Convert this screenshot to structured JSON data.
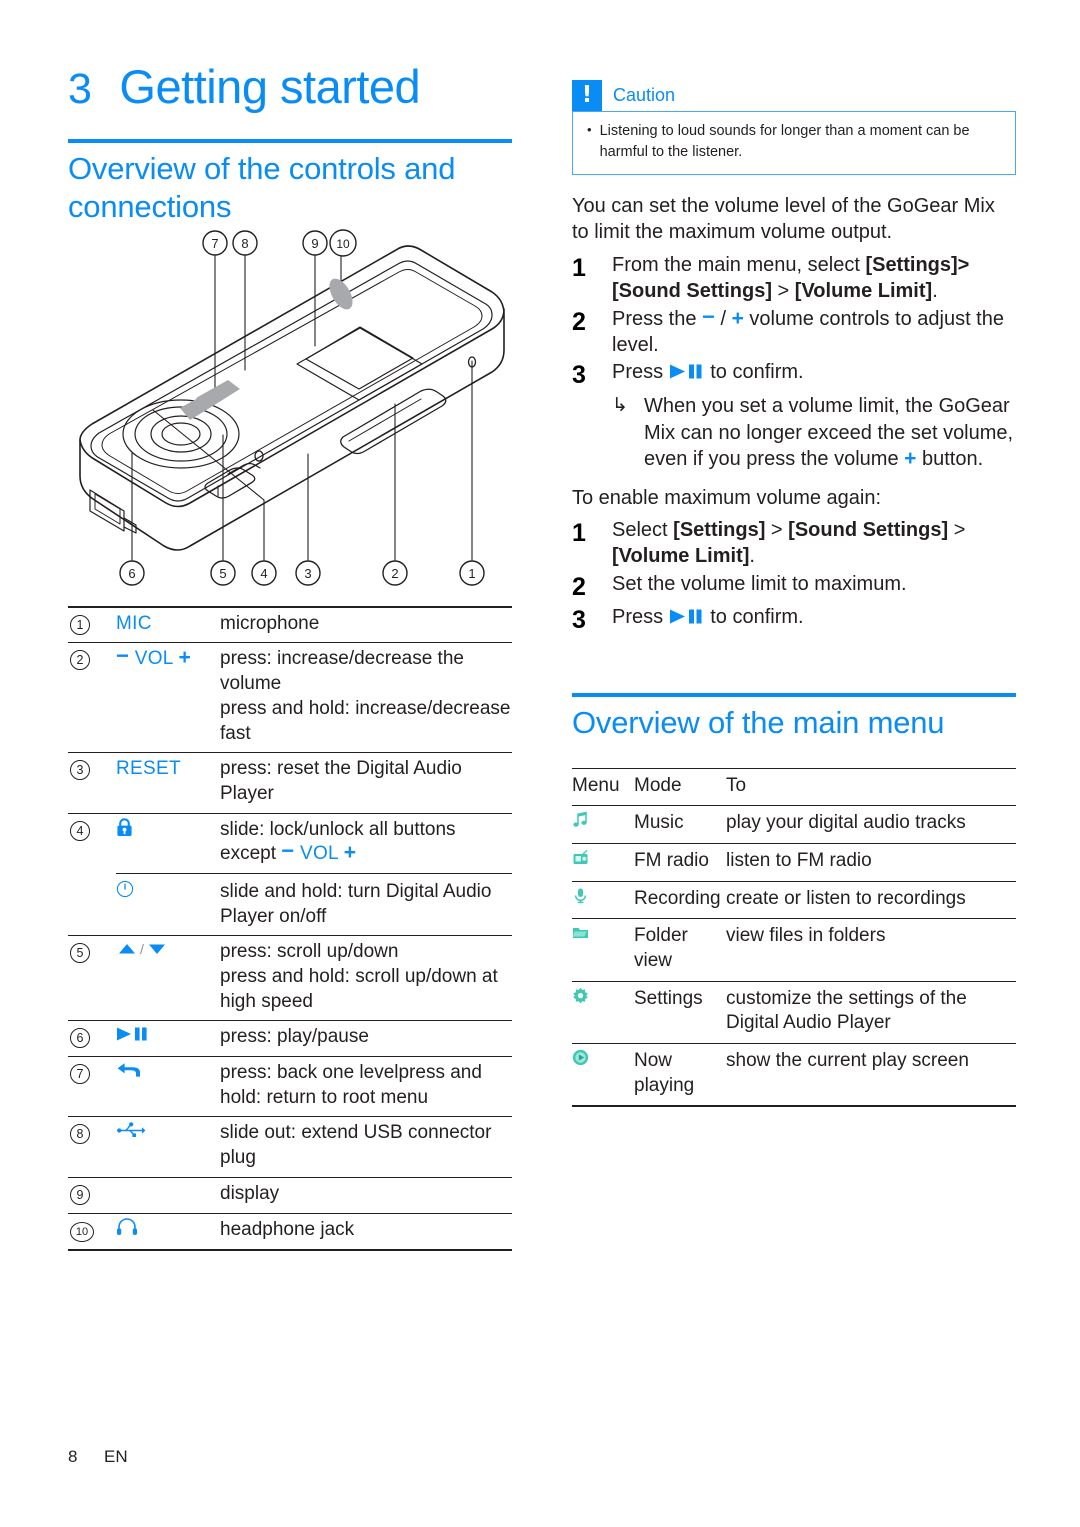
{
  "chapter": {
    "number": "3",
    "title": "Getting started"
  },
  "sections": {
    "controls_heading_line1": "Overview of the controls and",
    "controls_heading_line2": "connections",
    "main_menu_heading": "Overview of the main menu"
  },
  "caution": {
    "icon": "exclamation-icon",
    "bang": "!",
    "title": "Caution",
    "bullet": "•",
    "text": "Listening to loud sounds for longer than a moment can be harmful to the listener."
  },
  "volume_limit": {
    "intro": "You can set the volume level of the GoGear Mix to limit the maximum volume output.",
    "steps": [
      {
        "n": "1",
        "pre": "From the main menu, select ",
        "bold1": "[Settings]>[Sound Settings]",
        "mid": " > ",
        "bold2": "[Volume Limit]",
        "post": "."
      },
      {
        "n": "2",
        "pre": "Press the ",
        "minus": "−",
        "sep": " / ",
        "plus": "+",
        "post": " volume controls to adjust the level."
      },
      {
        "n": "3",
        "pre": "Press ",
        "glyph": "play-pause-icon",
        "post": " to confirm."
      }
    ],
    "note": {
      "arrow": "↳",
      "pre": "When you set a volume limit, the GoGear Mix can no longer exceed the set volume, even if you press the volume ",
      "plus": "+",
      "post": " button."
    },
    "reenable_intro": "To enable maximum volume again:",
    "reenable_steps": [
      {
        "n": "1",
        "pre": "Select ",
        "bold1": "[Settings]",
        "mid": " > ",
        "bold2": "[Sound Settings]",
        "mid2": " >",
        "bold3": "[Volume Limit]",
        "post": "."
      },
      {
        "n": "2",
        "pre": "Set the volume limit to maximum.",
        "post": ""
      },
      {
        "n": "3",
        "pre": "Press ",
        "glyph": "play-pause-icon",
        "post": " to confirm."
      }
    ]
  },
  "callouts": [
    "1",
    "2",
    "3",
    "4",
    "5",
    "6",
    "7",
    "8",
    "9",
    "10"
  ],
  "controls_table": {
    "rows": [
      {
        "num": "1",
        "icon_kind": "text",
        "icon_text": "MIC",
        "icon_name": "mic-label",
        "desc": [
          "microphone"
        ]
      },
      {
        "num": "2",
        "icon_kind": "vol",
        "icon_text": "− VOL +",
        "icon_name": "volume-label",
        "desc": [
          "press: increase/decrease the volume",
          "press and hold: increase/decrease fast"
        ]
      },
      {
        "num": "3",
        "icon_kind": "text",
        "icon_text": "RESET",
        "icon_name": "reset-label",
        "desc": [
          "press: reset the Digital Audio Player"
        ]
      },
      {
        "num": "4",
        "icon_kind": "lock",
        "icon_text": "",
        "icon_name": "lock-icon",
        "desc_pre": "slide: lock/unlock all buttons except ",
        "desc_vol": "− VOL +"
      },
      {
        "num": "",
        "icon_kind": "power",
        "icon_text": "",
        "icon_name": "power-icon",
        "desc": [
          "slide and hold: turn Digital Audio Player on/off"
        ],
        "sub": true
      },
      {
        "num": "5",
        "icon_kind": "updown",
        "icon_text": "▲ / ▼",
        "icon_name": "scroll-up-down-icon",
        "desc": [
          "press: scroll up/down",
          "press and hold: scroll up/down at high speed"
        ]
      },
      {
        "num": "6",
        "icon_kind": "playpause",
        "icon_text": "",
        "icon_name": "play-pause-icon",
        "desc": [
          "press: play/pause"
        ]
      },
      {
        "num": "7",
        "icon_kind": "back",
        "icon_text": "",
        "icon_name": "back-arrow-icon",
        "desc": [
          "press: back one levelpress and hold: return to root menu"
        ]
      },
      {
        "num": "8",
        "icon_kind": "usb",
        "icon_text": "",
        "icon_name": "usb-icon",
        "desc": [
          "slide out: extend USB connector plug"
        ]
      },
      {
        "num": "9",
        "icon_kind": "none",
        "icon_text": "",
        "icon_name": "no-icon",
        "desc": [
          "display"
        ]
      },
      {
        "num": "10",
        "icon_kind": "headphone",
        "icon_text": "",
        "icon_name": "headphone-icon",
        "desc": [
          "headphone jack"
        ]
      }
    ]
  },
  "menu_table": {
    "headers": [
      "Menu",
      "Mode",
      "To"
    ],
    "rows": [
      {
        "icon": "music-note-icon",
        "mode": "Music",
        "to": "play your digital audio tracks"
      },
      {
        "icon": "fm-radio-icon",
        "mode": "FM radio",
        "to": "listen to FM radio"
      },
      {
        "icon": "microphone-icon",
        "mode": "Recording",
        "to": "create or listen to recordings"
      },
      {
        "icon": "folder-icon",
        "mode": "Folder view",
        "to": "view files in folders"
      },
      {
        "icon": "gear-icon",
        "mode": "Settings",
        "to": "customize the settings of the Digital Audio Player"
      },
      {
        "icon": "now-playing-icon",
        "mode": "Now playing",
        "to": "show the current play screen"
      }
    ]
  },
  "footer": {
    "page": "8",
    "lang": "EN"
  },
  "colors": {
    "accent_blue": "#0a8cf5",
    "icon_teal": "#4fd1bd",
    "text": "#231f20"
  }
}
